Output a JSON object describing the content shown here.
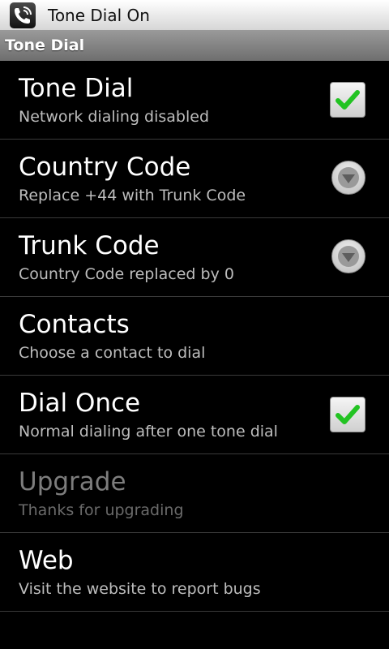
{
  "notification": {
    "title": "Tone Dial On",
    "icon": "phone-signal-icon"
  },
  "titlebar": {
    "title": "Tone Dial"
  },
  "preferences": [
    {
      "title": "Tone Dial",
      "summary": "Network dialing disabled",
      "widget": "checkbox",
      "checked": true,
      "enabled": true
    },
    {
      "title": "Country Code",
      "summary": "Replace +44 with Trunk Code",
      "widget": "dropdown",
      "enabled": true
    },
    {
      "title": "Trunk Code",
      "summary": "Country Code replaced by 0",
      "widget": "dropdown",
      "enabled": true
    },
    {
      "title": "Contacts",
      "summary": "Choose a contact to dial",
      "widget": "none",
      "enabled": true
    },
    {
      "title": "Dial Once",
      "summary": "Normal dialing after one tone dial",
      "widget": "checkbox",
      "checked": true,
      "enabled": true
    },
    {
      "title": "Upgrade",
      "summary": "Thanks for upgrading",
      "widget": "none",
      "enabled": false
    },
    {
      "title": "Web",
      "summary": "Visit the website to report bugs",
      "widget": "none",
      "enabled": true
    }
  ],
  "colors": {
    "check_green": "#22c322",
    "background": "#000000",
    "titlebar": "#7d7d7d"
  }
}
